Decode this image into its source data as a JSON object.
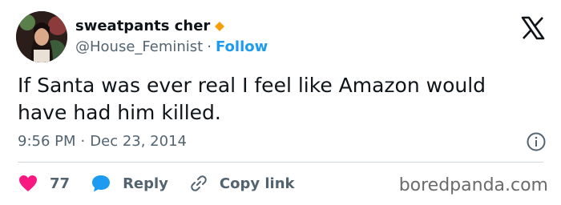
{
  "author": {
    "display_name": "sweatpants cher",
    "handle": "@House_Feminist",
    "follow_label": "Follow",
    "verified_color": "#f59f0b"
  },
  "tweet": {
    "text": "If Santa was ever real I feel like Amazon would have had him killed.",
    "time": "9:56 PM",
    "date": "Dec 23, 2014"
  },
  "actions": {
    "like_count": "77",
    "reply_label": "Reply",
    "copy_link_label": "Copy link"
  },
  "watermark": "boredpanda.com",
  "colors": {
    "like": "#f91880",
    "reply": "#1d9bf0",
    "text": "#0f1419",
    "secondary": "#536471"
  },
  "icons": [
    "x-logo-icon",
    "verified-badge-icon",
    "info-icon",
    "heart-icon",
    "reply-bubble-icon",
    "link-icon"
  ]
}
